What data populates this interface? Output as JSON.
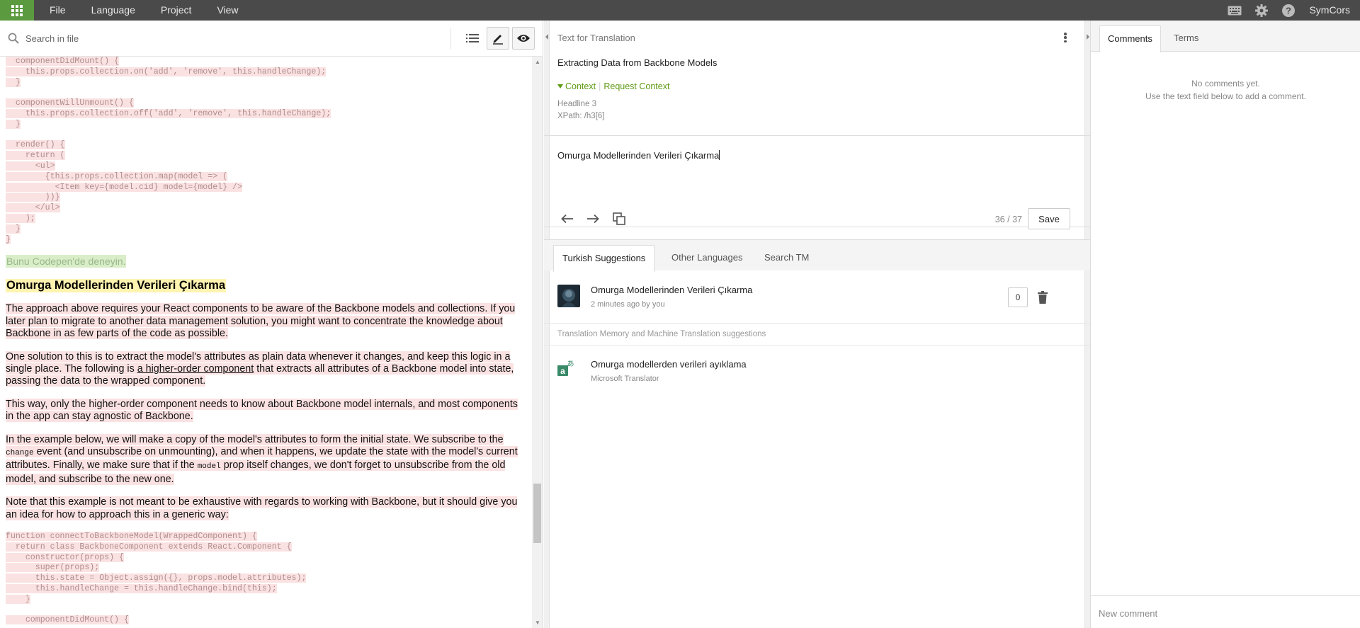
{
  "topbar": {
    "menu": [
      "File",
      "Language",
      "Project",
      "View"
    ],
    "user": "SymCors",
    "accent": "#5b9a3f"
  },
  "editor": {
    "search_placeholder": "Search in file",
    "code1": [
      "  componentDidMount() {",
      "    this.props.collection.on('add', 'remove', this.handleChange);",
      "  }",
      "",
      "  componentWillUnmount() {",
      "    this.props.collection.off('add', 'remove', this.handleChange);",
      "  }",
      "",
      "  render() {",
      "    return (",
      "      <ul>",
      "        {this.props.collection.map(model => (",
      "          <Item key={model.cid} model={model} />",
      "        ))}",
      "      </ul>",
      "    );",
      "  }",
      "}"
    ],
    "try_link": "Bunu Codepen'de deneyin.",
    "heading": "Omurga Modellerinden Verileri Çıkarma",
    "p1": "The approach above requires your React components to be aware of the Backbone models and collections. If you later plan to migrate to another data management solution, you might want to concentrate the knowledge about Backbone in as few parts of the code as possible.",
    "p2_a": "One solution to this is to extract the model's attributes as plain data whenever it changes, and keep this logic in a single place. The following is ",
    "p2_link": "a higher-order component",
    "p2_b": " that extracts all attributes of a Backbone model into state, passing the data to the wrapped component.",
    "p3": "This way, only the higher-order component needs to know about Backbone model internals, and most components in the app can stay agnostic of Backbone.",
    "p4_a": "In the example below, we will make a copy of the model's attributes to form the initial state. We subscribe to the ",
    "p4_code1": "change",
    "p4_b": " event (and unsubscribe on unmounting), and when it happens, we update the state with the model's current attributes. Finally, we make sure that if the ",
    "p4_code2": "model",
    "p4_c": " prop itself changes, we don't forget to unsubscribe from the old model, and subscribe to the new one.",
    "p5": "Note that this example is not meant to be exhaustive with regards to working with Backbone, but it should give you an idea for how to approach this in a generic way:",
    "code2": [
      "function connectToBackboneModel(WrappedComponent) {",
      "  return class BackboneComponent extends React.Component {",
      "    constructor(props) {",
      "      super(props);",
      "      this.state = Object.assign({}, props.model.attributes);",
      "      this.handleChange = this.handleChange.bind(this);",
      "    }",
      "",
      "    componentDidMount() {"
    ]
  },
  "translation": {
    "header": "Text for Translation",
    "source": "Extracting Data from Backbone Models",
    "context_label": "Context",
    "request_context": "Request Context",
    "meta_type": "Headline 3",
    "meta_xpath": "XPath: /h3[6]",
    "value": "Omurga Modellerinden Verileri Çıkarma",
    "counter": "36 / 37",
    "save": "Save"
  },
  "suggestions": {
    "tabs": [
      "Turkish Suggestions",
      "Other Languages",
      "Search TM"
    ],
    "user_item": {
      "text": "Omurga Modellerinden Verileri Çıkarma",
      "by": "2 minutes ago by you",
      "votes": "0"
    },
    "tm_header": "Translation Memory and Machine Translation suggestions",
    "mt_item": {
      "text": "Omurga modellerden verileri ayıklama",
      "source": "Microsoft Translator"
    }
  },
  "comments": {
    "tabs": [
      "Comments",
      "Terms"
    ],
    "empty_line1": "No comments yet.",
    "empty_line2": "Use the text field below to add a comment.",
    "new_placeholder": "New comment"
  }
}
